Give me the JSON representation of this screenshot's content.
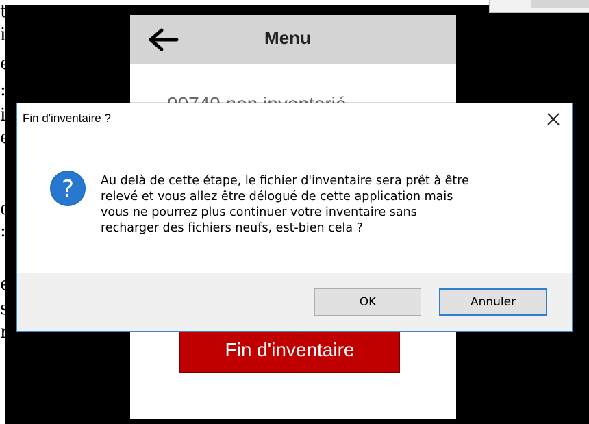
{
  "left_fragments": [
    "t",
    "i",
    "e",
    ":",
    "i",
    "e",
    "c",
    ":",
    "e",
    "s",
    "r"
  ],
  "app": {
    "title": "Menu",
    "behind_text": "00749    non inventorié",
    "finish_button": "Fin d'inventaire"
  },
  "dialog": {
    "title": "Fin d'inventaire ?",
    "icon": "question-icon",
    "message_lines": [
      "Au delà de cette étape, le fichier d'inventaire sera prêt à être",
      "relevé et vous allez être délogué de cette application mais",
      "vous ne pourrez plus continuer votre inventaire sans",
      "recharger des fichiers neufs, est-bien cela ?"
    ],
    "ok_label": "OK",
    "cancel_label": "Annuler"
  },
  "colors": {
    "accent": "#2f7fd0",
    "finish_button": "#c00000",
    "header": "#d4d4d4"
  }
}
